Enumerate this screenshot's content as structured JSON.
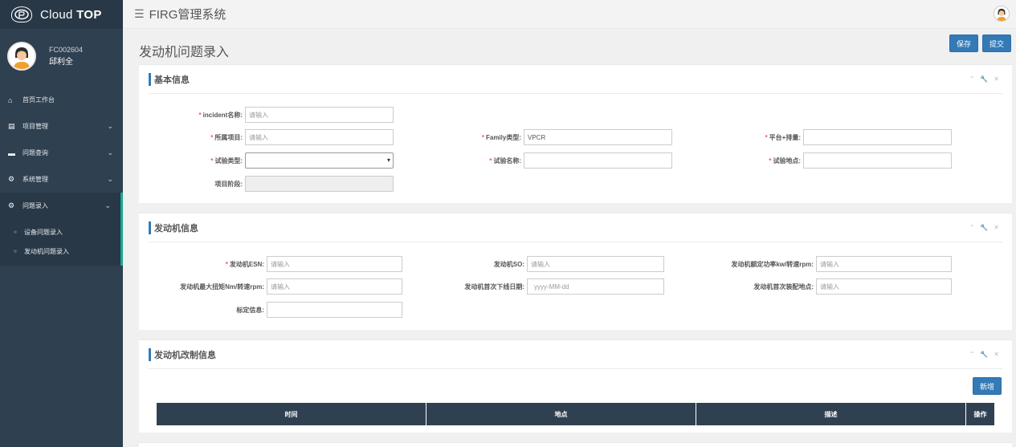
{
  "brand": {
    "name_a": "Cloud ",
    "name_b": "TOP"
  },
  "user": {
    "id": "FC002604",
    "name": "邱利全"
  },
  "nav": [
    {
      "label": "首页工作台",
      "icon": "home-icon",
      "chevron": false
    },
    {
      "label": "项目管理",
      "icon": "list-icon",
      "chevron": true
    },
    {
      "label": "问题查询",
      "icon": "comment-icon",
      "chevron": true
    },
    {
      "label": "系统管理",
      "icon": "cogs-icon",
      "chevron": true
    },
    {
      "label": "问题录入",
      "icon": "cogs-icon",
      "chevron": true
    }
  ],
  "sub_nav": [
    "设备问题录入",
    "发动机问题录入"
  ],
  "header": {
    "title": "FIRG管理系统"
  },
  "page": {
    "title": "发动机问题录入",
    "save": "保存",
    "submit": "提交"
  },
  "basic": {
    "title": "基本信息",
    "fields": {
      "incident": {
        "label": "incident名称:",
        "required": "*",
        "placeholder": "请输入"
      },
      "project": {
        "label": "所属项目:",
        "required": "*",
        "placeholder": "请输入"
      },
      "family": {
        "label": "Family类型:",
        "required": "*",
        "value": "VPCR"
      },
      "platform": {
        "label": "平台+排量:",
        "required": "*",
        "value": ""
      },
      "test_type": {
        "label": "试验类型:",
        "required": "*",
        "value": ""
      },
      "test_name": {
        "label": "试验名称:",
        "required": "*",
        "value": ""
      },
      "test_site": {
        "label": "试验地点:",
        "required": "*",
        "value": ""
      },
      "stage": {
        "label": "项目阶段:",
        "value": ""
      }
    }
  },
  "engine": {
    "title": "发动机信息",
    "fields": {
      "esn": {
        "label": "发动机ESN:",
        "required": "*",
        "placeholder": "请输入"
      },
      "so": {
        "label": "发动机SO:",
        "placeholder": "请输入"
      },
      "rated": {
        "label": "发动机额定功率kw/转速rpm:",
        "placeholder": "请输入"
      },
      "torque": {
        "label": "发动机最大扭矩Nm/转速rpm:",
        "placeholder": "请输入"
      },
      "offline_date": {
        "label": "发动机首次下线日期:",
        "placeholder": "yyyy-MM-dd"
      },
      "assembly_site": {
        "label": "发动机首次装配地点:",
        "placeholder": "请输入"
      },
      "calibration": {
        "label": "标定信息:",
        "value": ""
      }
    }
  },
  "modification": {
    "title": "发动机改制信息",
    "add": "新增",
    "columns": [
      "时间",
      "地点",
      "描述",
      "操作"
    ]
  },
  "tools": {
    "collapse": "⌃",
    "wrench": "🔧",
    "close": "✕"
  },
  "colors": {
    "sidebar": "#2f4050",
    "primary": "#337ab7",
    "active_border": "#19aa8d",
    "required": "#ed5565"
  }
}
